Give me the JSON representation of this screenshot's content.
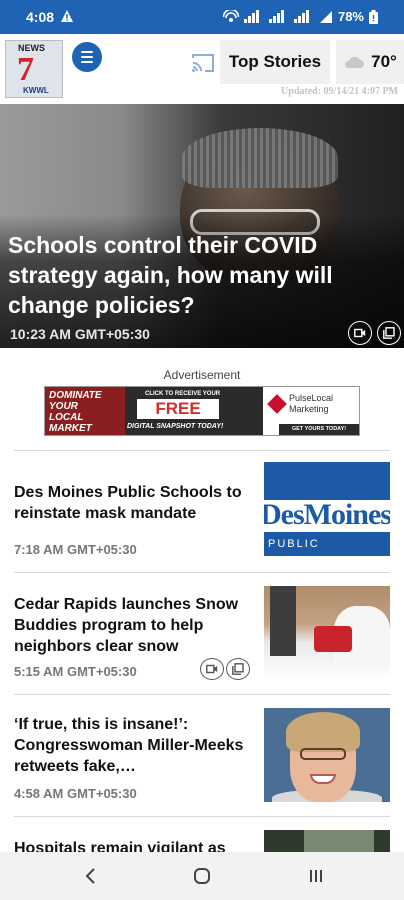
{
  "status_bar": {
    "time": "4:08",
    "battery": "78%",
    "icons": [
      "warning-icon",
      "wifi-icon",
      "signal-icon",
      "battery-icon"
    ]
  },
  "header": {
    "logo": {
      "top": "NEWS",
      "number": "7",
      "bottom": "KWWL"
    },
    "top_stories_label": "Top Stories",
    "temperature": "70°",
    "updated": "Updated: 09/14/21 4:07 PM"
  },
  "hero": {
    "title": "Schools control their COVID strategy again, how many will change policies?",
    "time": "10:23 AM GMT+05:30"
  },
  "ad": {
    "label": "Advertisement",
    "line1": "DOMINATE",
    "line2": "YOUR",
    "line3": "LOCAL",
    "line4": "MARKET",
    "click": "CLICK TO RECEIVE YOUR",
    "free": "FREE",
    "snapshot": "DIGITAL SNAPSHOT TODAY!",
    "brand_line1": "PulseLocal",
    "brand_line2": "Marketing",
    "cta": "GET YOURS TODAY!"
  },
  "stories": [
    {
      "headline": "Des Moines Public Schools to reinstate mask mandate",
      "time": "7:18 AM GMT+05:30",
      "thumb_text": "DesMoines",
      "thumb_sub": "PUBLIC SCHOOLS"
    },
    {
      "headline": "Cedar Rapids launches Snow Buddies program to help neighbors clear snow",
      "time": "5:15 AM GMT+05:30"
    },
    {
      "headline": "‘If true, this is insane!’: Congresswoman Miller-Meeks retweets fake,…",
      "time": "4:58 AM GMT+05:30"
    },
    {
      "headline": "Hospitals remain vigilant as"
    }
  ],
  "colors": {
    "brand_blue": "#1f63b4",
    "logo_red": "#d4212b",
    "time_gray": "#777777"
  }
}
